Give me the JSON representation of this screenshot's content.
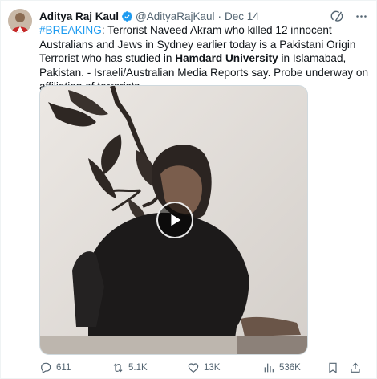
{
  "author": {
    "name": "Aditya Raj Kaul",
    "handle": "@AdityaRajKaul",
    "separator": "·",
    "date": "Dec 14"
  },
  "tweet": {
    "hashtag": "#BREAKING",
    "text_part1": ": Terrorist Naveed Akram who killed 12 innocent Australians and Jews in Sydney earlier today is a Pakistani Origin Terrorist who has studied in ",
    "bold_text": "Hamdard University",
    "text_part2": " in Islamabad, Pakistan. - Israeli/Australian Media Reports say. Probe underway on affiliation of terrorists."
  },
  "actions": {
    "replies": "611",
    "reposts": "5.1K",
    "likes": "13K",
    "views": "536K"
  },
  "colors": {
    "accent": "#1d9bf0",
    "muted": "#536471"
  }
}
